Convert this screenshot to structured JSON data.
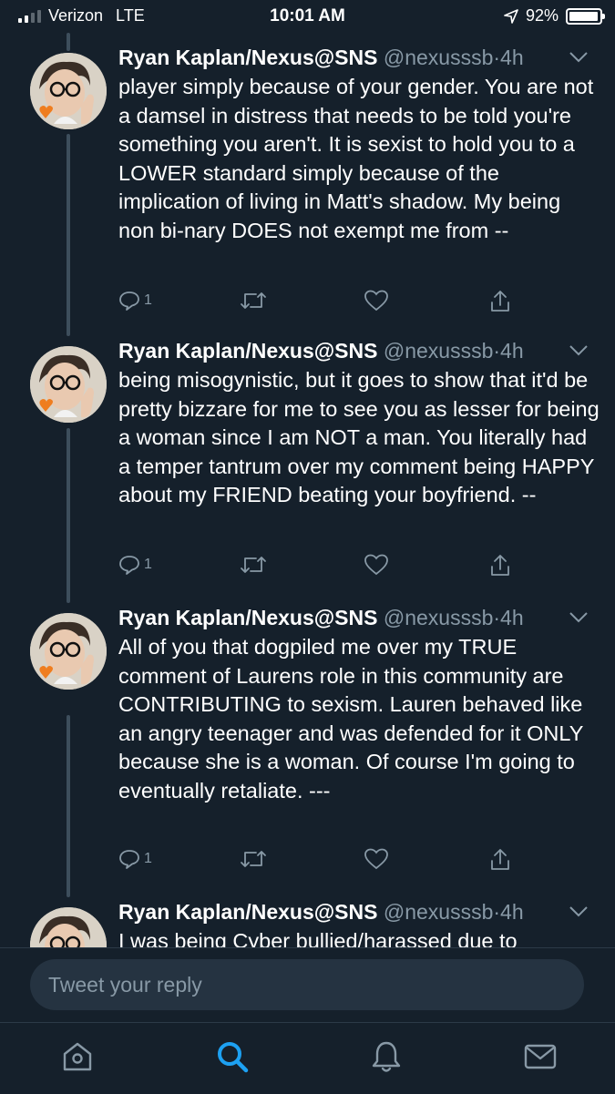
{
  "status_bar": {
    "carrier": "Verizon",
    "network": "LTE",
    "time": "10:01 AM",
    "battery": "92%",
    "battery_level": 0.92
  },
  "tweets": [
    {
      "name": "Ryan Kaplan/Nexus@SNS",
      "handle": "@nexusssb",
      "time": "4h",
      "text": "player simply because of your gender. You are not a damsel in distress that needs to be told you're something you aren't. It is sexist to hold you to a LOWER standard simply because of the implication of living in Matt's shadow. My being non bi-nary DOES not exempt me from --",
      "replies": "1"
    },
    {
      "name": "Ryan Kaplan/Nexus@SNS",
      "handle": "@nexusssb",
      "time": "4h",
      "text": "being misogynistic, but it goes to show that it'd be pretty bizzare for me to see you as lesser for being a woman since I am NOT a man. You literally had a temper tantrum over my comment being HAPPY about my FRIEND beating your boyfriend. --",
      "replies": "1"
    },
    {
      "name": "Ryan Kaplan/Nexus@SNS",
      "handle": "@nexusssb",
      "time": "4h",
      "text": "All of you that dogpiled me over my TRUE comment of Laurens role in this community are CONTRIBUTING to sexism. Lauren behaved like an angry teenager and was defended for it ONLY because she is a woman. Of course I'm going to eventually retaliate. ---",
      "replies": "1"
    },
    {
      "name": "Ryan Kaplan/Nexus@SNS",
      "handle": "@nexusssb",
      "time": "4h",
      "text": "I was being Cyber bullied/harassed due to"
    }
  ],
  "reply": {
    "placeholder": "Tweet your reply"
  },
  "tabs": [
    "home-icon",
    "search-icon",
    "notifications-icon",
    "messages-icon"
  ],
  "colors": {
    "background": "#15202b",
    "accent": "#1da1f2",
    "secondary_text": "#8899a6"
  }
}
